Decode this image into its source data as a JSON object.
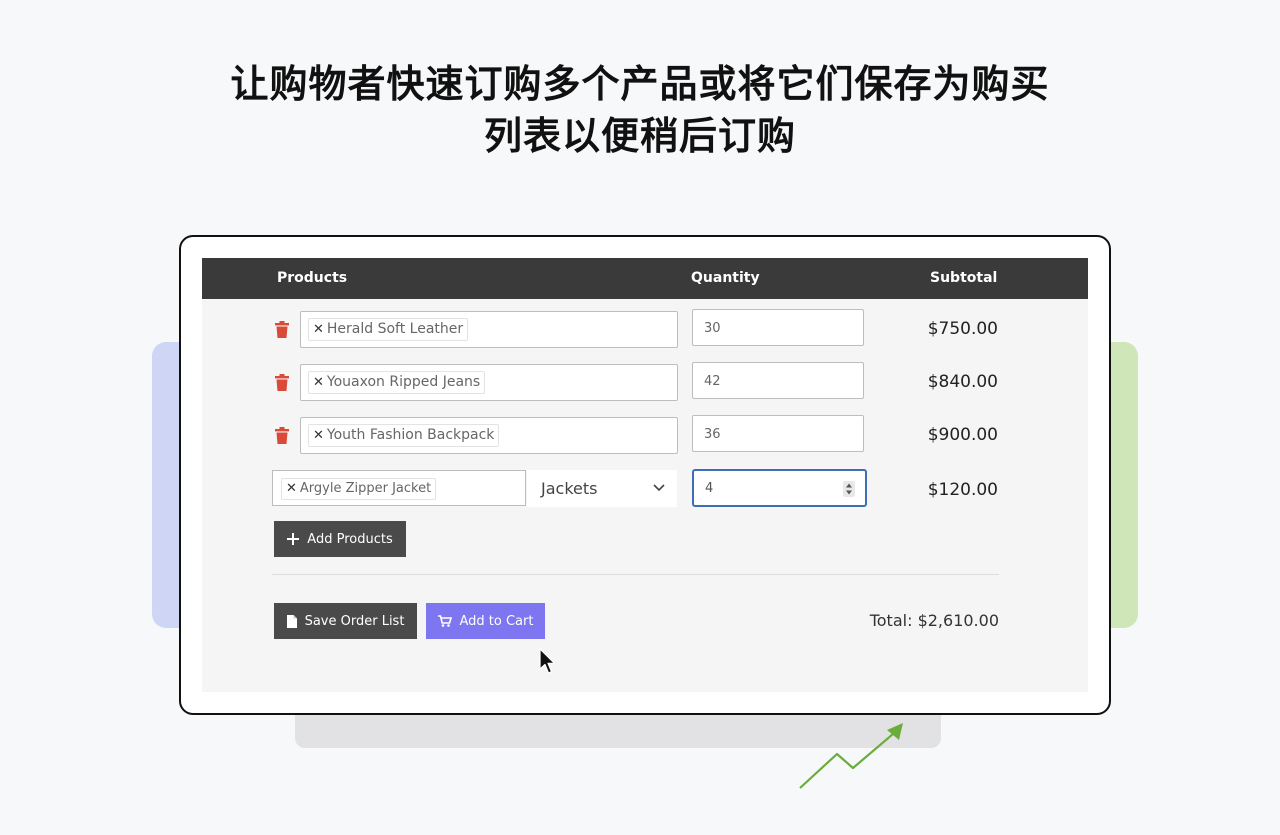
{
  "headline": {
    "line1": "让购物者快速订购多个产品或将它们保存为购买",
    "line2": "列表以便稍后订购"
  },
  "table": {
    "headers": {
      "products": "Products",
      "quantity": "Quantity",
      "subtotal": "Subtotal"
    },
    "rows": [
      {
        "product": "Herald Soft Leather",
        "quantity": "30",
        "subtotal": "$750.00"
      },
      {
        "product": "Youaxon Ripped Jeans",
        "quantity": "42",
        "subtotal": "$840.00"
      },
      {
        "product": "Youth Fashion Backpack",
        "quantity": "36",
        "subtotal": "$900.00"
      }
    ],
    "new_row": {
      "product": "Argyle Zipper Jacket",
      "category": "Jackets",
      "quantity": "4",
      "subtotal": "$120.00"
    }
  },
  "actions": {
    "add_products": "Add Products",
    "save_order_list": "Save Order List",
    "add_to_cart": "Add to Cart"
  },
  "total": {
    "label": "Total:",
    "value": "$2,610.00"
  },
  "icons": {
    "remove": "trash-icon",
    "tag_remove": "close-icon",
    "add": "plus-icon",
    "save": "document-icon",
    "cart": "cart-icon",
    "dropdown": "chevron-down-icon",
    "pointer": "cursor-icon"
  },
  "colors": {
    "header_bg": "#3a3a3a",
    "dark_button": "#4a4a4a",
    "accent_purple": "#7d76f0",
    "delete_red": "#d94a38",
    "focus_blue": "#3d6fb8",
    "deco_blue": "#cfd5f5",
    "deco_green": "#cfe6b8",
    "arrow_green": "#6aad3a"
  }
}
